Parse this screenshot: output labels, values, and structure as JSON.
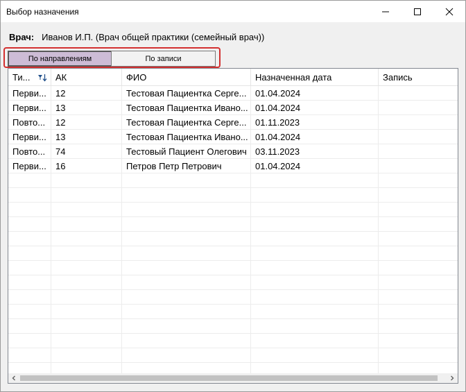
{
  "window": {
    "title": "Выбор назначения"
  },
  "doctor": {
    "label": "Врач:",
    "value": "Иванов И.П. (Врач общей практики (семейный врач))"
  },
  "tabs": [
    {
      "label": "По направлениям",
      "active": true
    },
    {
      "label": "По записи",
      "active": false
    }
  ],
  "grid": {
    "columns": [
      "Ти...",
      "АК",
      "ФИО",
      "Назначенная дата",
      "Запись"
    ],
    "rows": [
      [
        "Перви...",
        "12",
        "Тестовая Пациентка Серге...",
        "01.04.2024",
        ""
      ],
      [
        "Перви...",
        "13",
        "Тестовая Пациентка Ивано...",
        "01.04.2024",
        ""
      ],
      [
        "Повто...",
        "12",
        "Тестовая Пациентка Серге...",
        "01.11.2023",
        ""
      ],
      [
        "Перви...",
        "13",
        "Тестовая Пациентка Ивано...",
        "01.04.2024",
        ""
      ],
      [
        "Повто...",
        "74",
        "Тестовый Пациент Олегович",
        "03.11.2023",
        ""
      ],
      [
        "Перви...",
        "16",
        "Петров Петр Петрович",
        "01.04.2024",
        ""
      ]
    ]
  },
  "icons": {
    "minimize": "minimize-icon",
    "maximize": "maximize-icon",
    "close": "close-icon",
    "sort_filter": "filter-sort-icon",
    "scroll_left": "chevron-left-icon",
    "scroll_right": "chevron-right-icon"
  },
  "colors": {
    "active_tab": "#cdbcd6",
    "highlight_outline": "#d32f2f"
  }
}
